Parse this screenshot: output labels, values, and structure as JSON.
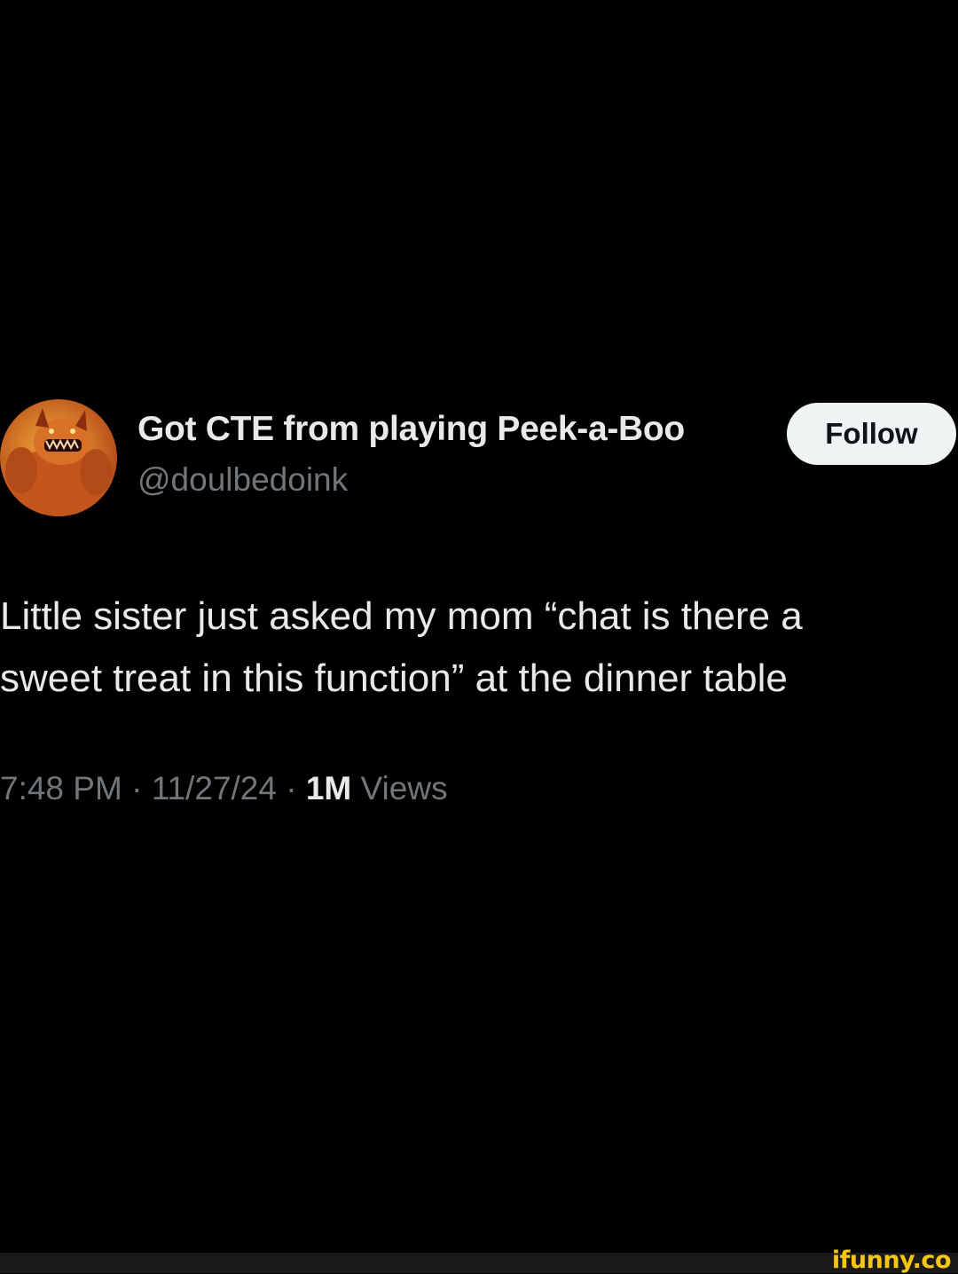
{
  "tweet": {
    "author": {
      "display_name": "Got CTE from playing Peek-a-Boo",
      "handle": "@doulbedoink",
      "avatar_icon": "orange-demon-avatar"
    },
    "follow_label": "Follow",
    "text": "Little sister just asked my mom “chat is there a\nsweet treat in this function” at the dinner table",
    "meta": {
      "time": "7:48 PM",
      "separator": " · ",
      "date": "11/27/24",
      "views_count": "1M",
      "views_label": "Views"
    }
  },
  "watermark": {
    "text": "ifunny.co"
  },
  "colors": {
    "background": "#000000",
    "primary_text": "#e7e9ea",
    "secondary_text": "#71767b",
    "follow_button_bg": "#eff3f4",
    "watermark": "#f5c518"
  }
}
